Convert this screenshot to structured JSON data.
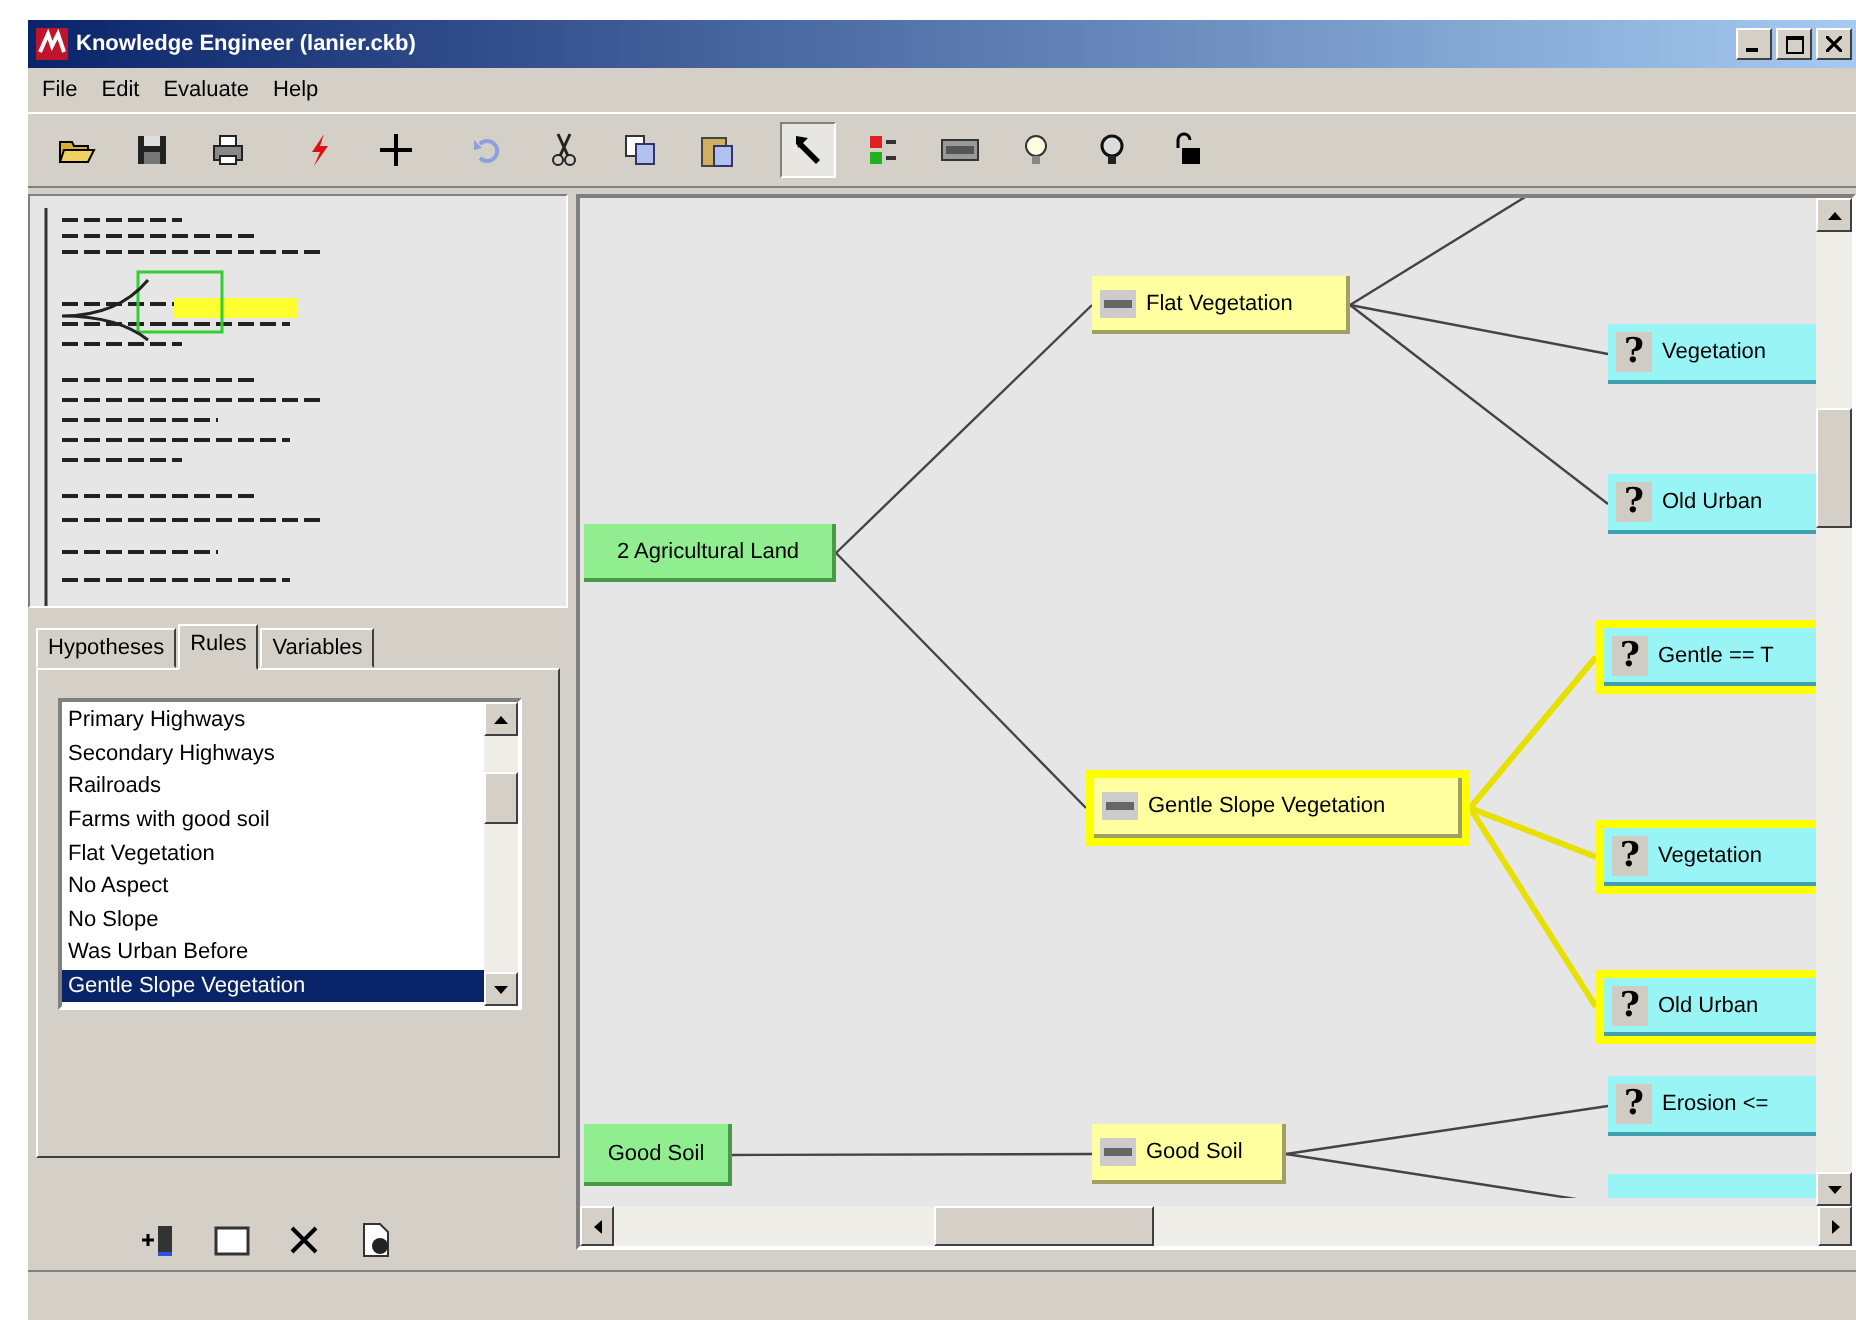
{
  "window": {
    "title": "Knowledge Engineer (lanier.ckb)"
  },
  "menu": [
    "File",
    "Edit",
    "Evaluate",
    "Help"
  ],
  "toolbar": [
    {
      "kind": "open",
      "selected": false
    },
    {
      "kind": "save",
      "selected": false
    },
    {
      "kind": "print",
      "selected": false
    },
    {
      "kind": "spark",
      "selected": false
    },
    {
      "kind": "cross",
      "selected": false
    },
    {
      "kind": "undo",
      "selected": false
    },
    {
      "kind": "cut",
      "selected": false
    },
    {
      "kind": "copy",
      "selected": false
    },
    {
      "kind": "paste",
      "selected": false
    },
    {
      "kind": "pointer",
      "selected": true
    },
    {
      "kind": "grid",
      "selected": false
    },
    {
      "kind": "bar",
      "selected": false
    },
    {
      "kind": "bulb",
      "selected": false
    },
    {
      "kind": "bulb-dark",
      "selected": false
    },
    {
      "kind": "lock",
      "selected": false
    }
  ],
  "tabs": [
    {
      "label": "Hypotheses",
      "selected": false
    },
    {
      "label": "Rules",
      "selected": true
    },
    {
      "label": "Variables",
      "selected": false
    }
  ],
  "rules": [
    {
      "label": "Primary Highways",
      "selected": false
    },
    {
      "label": "Secondary Highways",
      "selected": false
    },
    {
      "label": "Railroads",
      "selected": false
    },
    {
      "label": "Farms with good soil",
      "selected": false
    },
    {
      "label": "Flat Vegetation",
      "selected": false
    },
    {
      "label": "No Aspect",
      "selected": false
    },
    {
      "label": "No Slope",
      "selected": false
    },
    {
      "label": "Was Urban Before",
      "selected": false
    },
    {
      "label": "Gentle Slope Vegetation",
      "selected": true
    }
  ],
  "panel_tools": [
    {
      "kind": "add"
    },
    {
      "kind": "window"
    },
    {
      "kind": "delete"
    },
    {
      "kind": "find"
    }
  ],
  "diagram": {
    "nodes": [
      {
        "kind": "hypothesis",
        "label": "2 Agricultural Land",
        "highlighted": false
      },
      {
        "kind": "rule",
        "label": "Flat Vegetation",
        "highlighted": false
      },
      {
        "kind": "rule",
        "label": "Gentle Slope Vegetation",
        "highlighted": true
      },
      {
        "kind": "condition",
        "icon": "?",
        "label": "Vegetation",
        "highlighted": false
      },
      {
        "kind": "condition",
        "icon": "?",
        "label": "Old Urban",
        "highlighted": false
      },
      {
        "kind": "condition",
        "icon": "?",
        "label": "Gentle == T",
        "highlighted": true
      },
      {
        "kind": "condition",
        "icon": "?",
        "label": "Vegetation",
        "highlighted": true
      },
      {
        "kind": "condition",
        "icon": "?",
        "label": "Old Urban",
        "highlighted": true
      },
      {
        "kind": "condition",
        "icon": "?",
        "label": "Erosion <=",
        "highlighted": false
      },
      {
        "kind": "condition",
        "highlighted": false
      },
      {
        "kind": "hypothesis",
        "label": "Good Soil",
        "highlighted": false
      },
      {
        "kind": "rule",
        "label": "Good Soil",
        "highlighted": false
      }
    ],
    "edges": [
      {
        "highlighted": false
      },
      {
        "highlighted": false
      },
      {
        "highlighted": false
      },
      {
        "highlighted": false
      },
      {
        "highlighted": false
      },
      {
        "highlighted": true
      },
      {
        "highlighted": true
      },
      {
        "highlighted": true
      },
      {
        "highlighted": false
      },
      {
        "highlighted": false
      },
      {
        "highlighted": false
      }
    ]
  }
}
